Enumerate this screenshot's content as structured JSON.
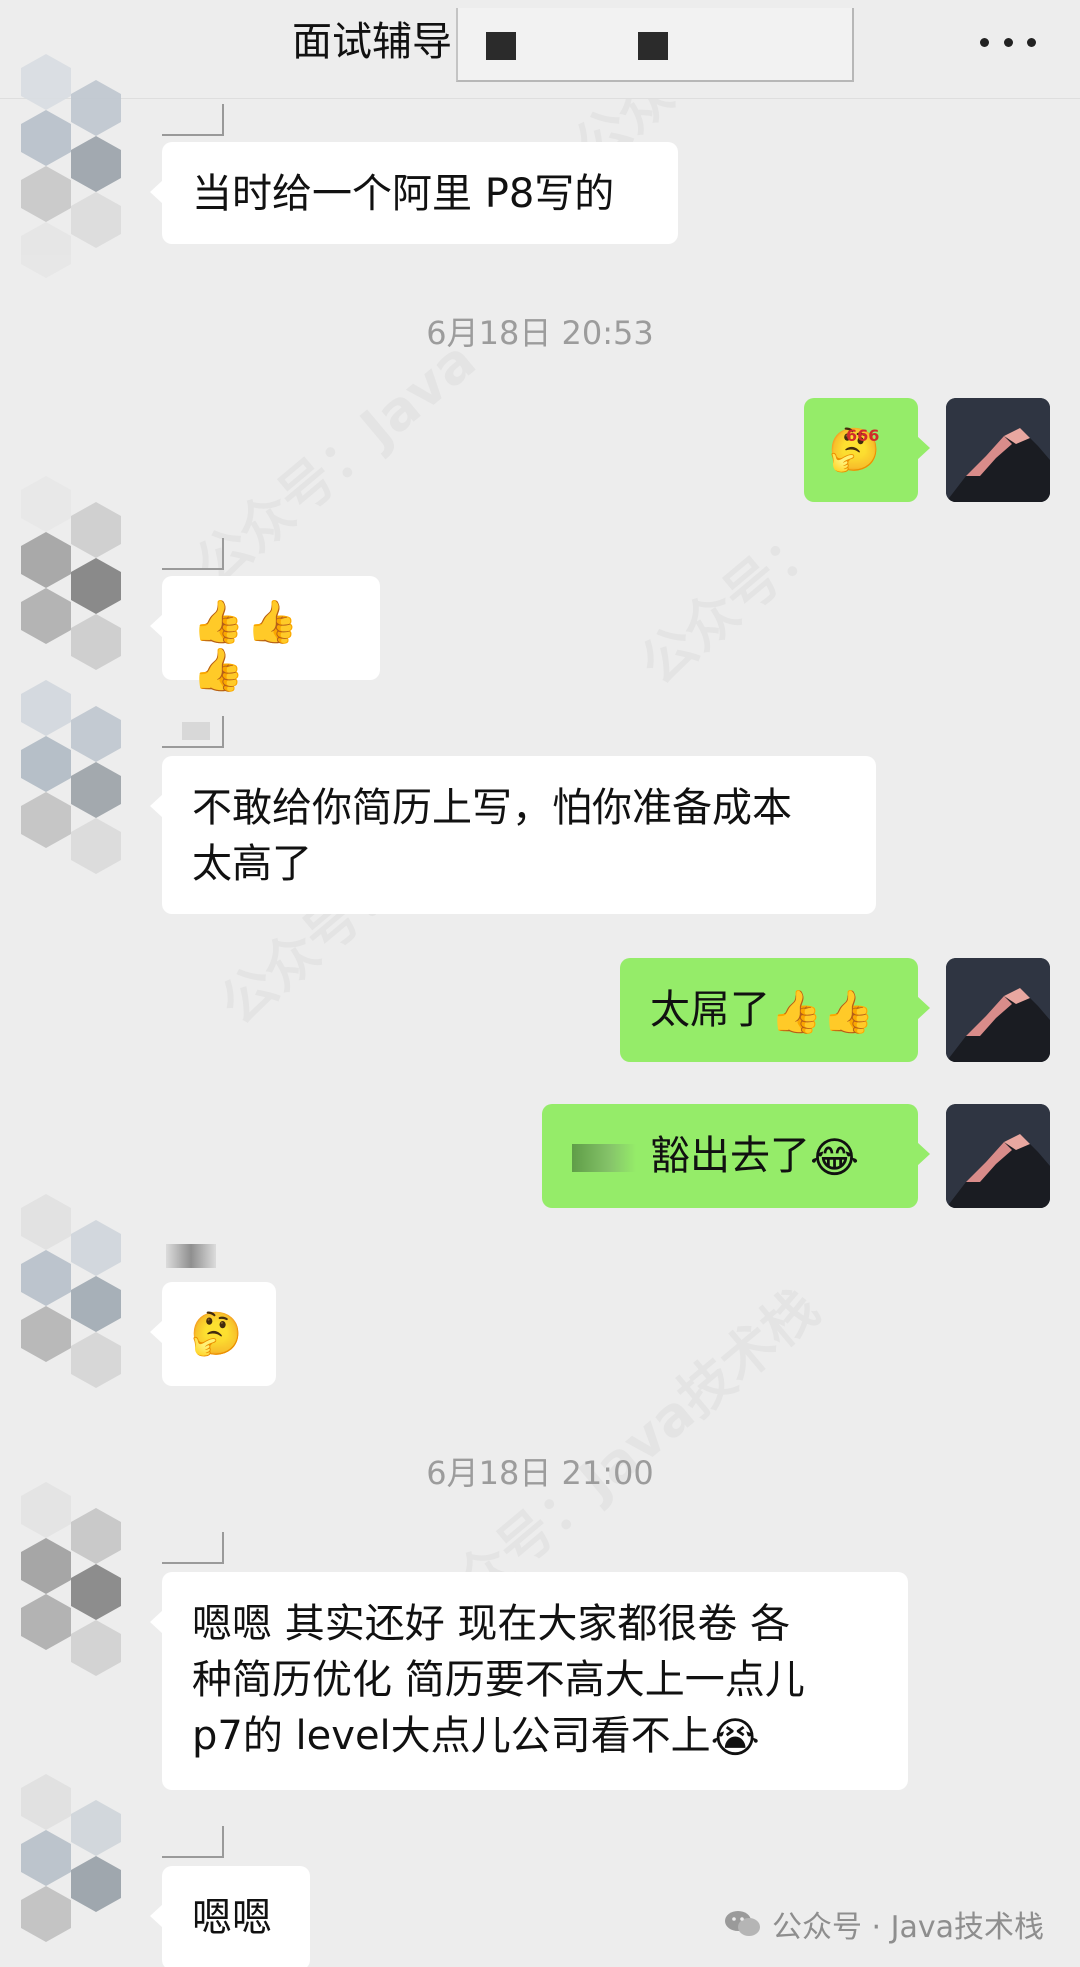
{
  "header": {
    "title": "面试辅导",
    "more_icon": "more-dots-icon"
  },
  "messages": [
    {
      "side": "left",
      "text": "当时给一个阿里 P8写的"
    },
    {
      "type": "time",
      "text": "6月18日 20:53"
    },
    {
      "side": "right",
      "emoji": "🤔",
      "emoji_badge": "666"
    },
    {
      "side": "left",
      "emoji": "👍👍👍"
    },
    {
      "side": "left",
      "line1": "不敢给你简历上写，怕你准备成本",
      "line2": "太高了"
    },
    {
      "side": "right",
      "text": "太屌了",
      "emoji": "👍👍"
    },
    {
      "side": "right",
      "text": "豁出去了",
      "emoji": "😂"
    },
    {
      "side": "left",
      "emoji": "🤔"
    },
    {
      "type": "time",
      "text": "6月18日 21:00"
    },
    {
      "side": "left",
      "line1": "嗯嗯  其实还好  现在大家都很卷  各",
      "line2": "种简历优化   简历要不高大上一点儿",
      "line3": "  p7的 level大点儿公司看不上",
      "emoji": "😭"
    },
    {
      "side": "left",
      "text": "嗯嗯"
    }
  ],
  "footer": {
    "watermark": "公众号 · Java技术栈"
  },
  "colors": {
    "background": "#ededed",
    "bubble_self": "#95ec69",
    "bubble_other": "#ffffff",
    "timestamp": "#9c9c9c"
  }
}
